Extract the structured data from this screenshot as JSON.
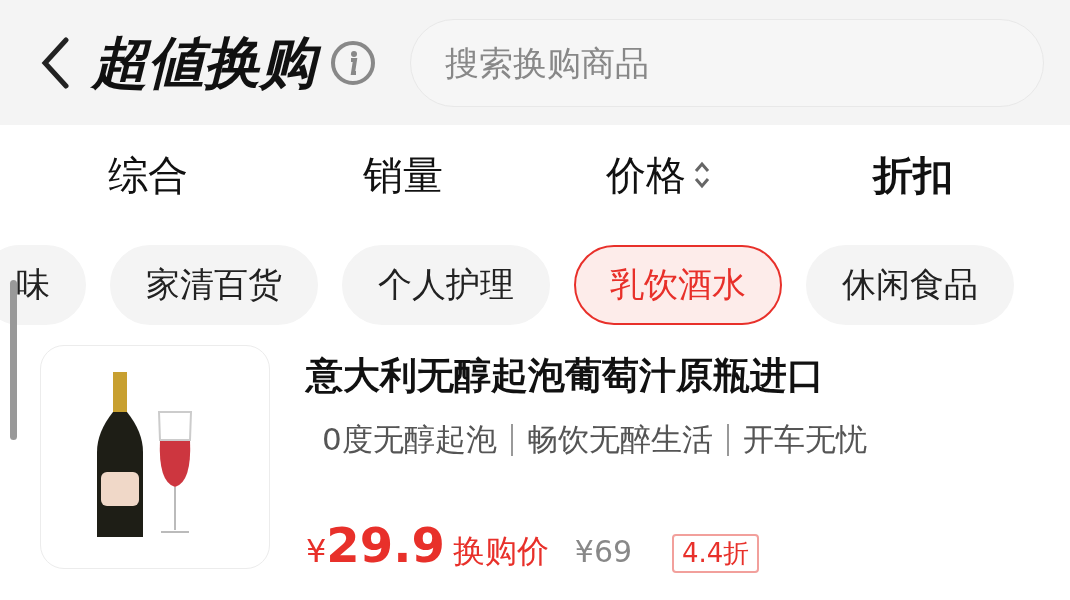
{
  "header": {
    "title": "超値换购",
    "search": {
      "placeholder": "搜索换购商品"
    }
  },
  "sort_tabs": [
    {
      "label": "综合",
      "selected": false,
      "kind": "plain"
    },
    {
      "label": "销量",
      "selected": false,
      "kind": "plain"
    },
    {
      "label": "价格",
      "selected": false,
      "kind": "sortable"
    },
    {
      "label": "折扣",
      "selected": true,
      "kind": "plain"
    }
  ],
  "categories": [
    {
      "label": "味",
      "selected": false
    },
    {
      "label": "家清百货",
      "selected": false
    },
    {
      "label": "个人护理",
      "selected": false
    },
    {
      "label": "乳饮酒水",
      "selected": true
    },
    {
      "label": "休闲食品",
      "selected": false
    }
  ],
  "products": [
    {
      "title": "意大利无醇起泡葡萄汁原瓶进口",
      "tags": [
        "0度无醇起泡",
        "畅饮无醉生活",
        "开车无忧"
      ],
      "currency": "¥",
      "price": "29.9",
      "price_label": "换购价",
      "original_price": "¥69",
      "discount": "4.4折"
    }
  ]
}
